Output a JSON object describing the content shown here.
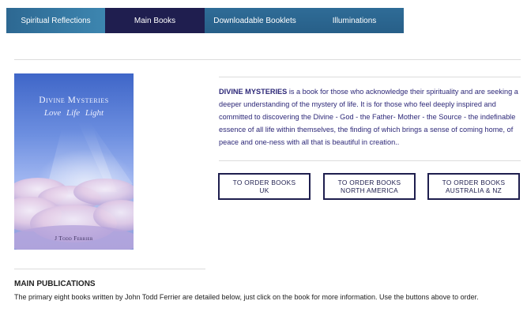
{
  "nav": {
    "tabs": [
      {
        "label": "Spiritual Reflections"
      },
      {
        "label": "Main Books"
      },
      {
        "label": "Downloadable Booklets"
      },
      {
        "label": "Illuminations"
      }
    ],
    "active_tab": "Main Books"
  },
  "book": {
    "cover_title": "Divine Mysteries",
    "cover_subtitle": "Love Life Light",
    "cover_author": "J Todd Ferrier",
    "name": "DIVINE MYSTERIES",
    "description": " is a book for those who acknowledge their spirituality and are seeking a deeper understanding of the mystery of life. It is for those who feel deeply inspired and committed to discovering the Divine - God - the Father- Mother - the Source - the indefinable essence of all life within themselves, the finding of which brings a sense of coming home, of peace and one-ness with all that is beautiful in creation.."
  },
  "order_buttons": {
    "uk": {
      "line1": "TO ORDER BOOKS",
      "line2": "UK"
    },
    "north_america": {
      "line1": "TO ORDER BOOKS",
      "line2": "NORTH AMERICA"
    },
    "australia": {
      "line1": "TO ORDER BOOKS",
      "line2": "AUSTRALIA & NZ"
    }
  },
  "publications": {
    "heading": "MAIN PUBLICATIONS",
    "text": "The primary eight books written by John Todd Ferrier are detailed below, just click on the book for more information. Use the buttons above to order."
  },
  "colors": {
    "nav_blue": "#2d6892",
    "nav_active": "#1f1e4f",
    "text_accent": "#2d2878"
  }
}
